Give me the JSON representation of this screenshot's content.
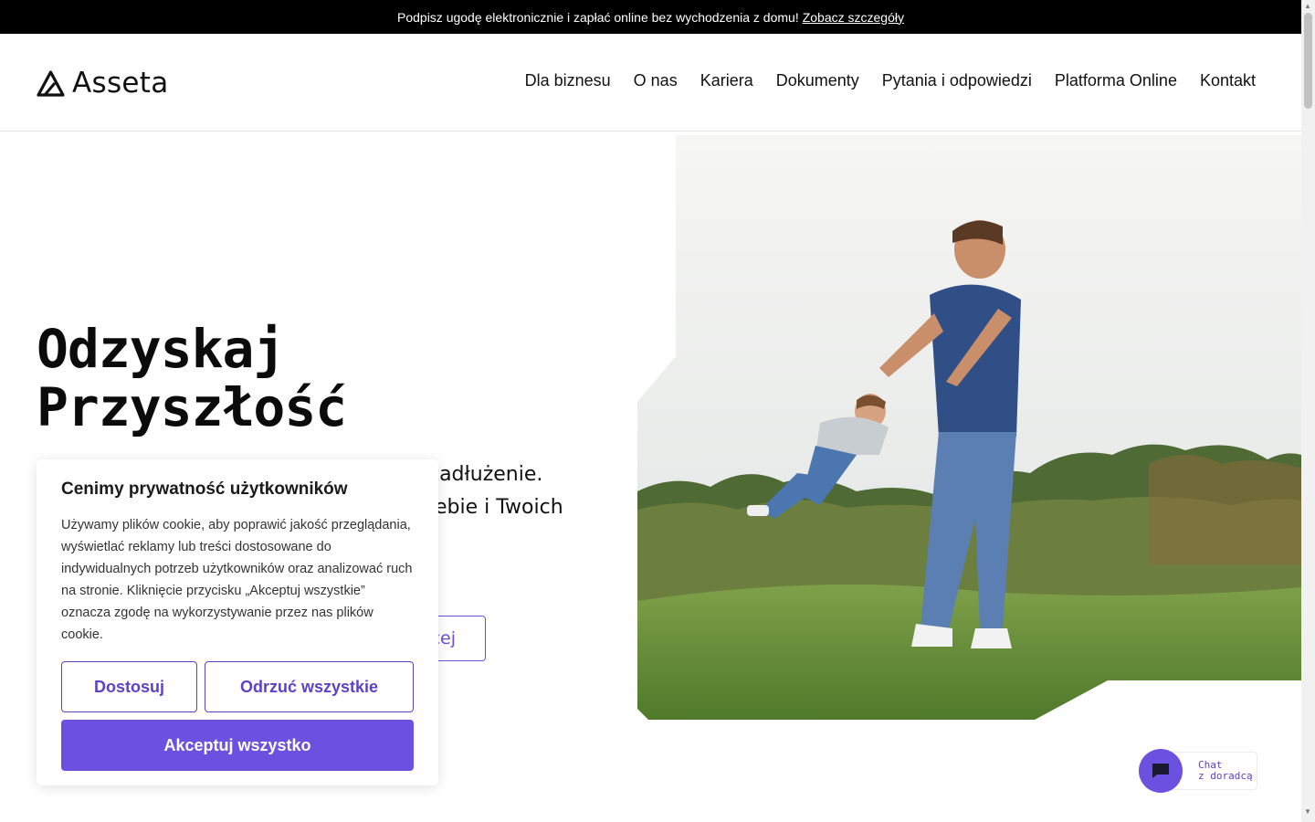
{
  "announcement": {
    "text": "Podpisz ugodę elektronicznie i zapłać online bez wychodzenia z domu!",
    "link": "Zobacz szczegóły"
  },
  "header": {
    "logo_text": "Asseta",
    "nav": [
      "Dla biznesu",
      "O nas",
      "Kariera",
      "Dokumenty",
      "Pytania i odpowiedzi",
      "Platforma Online",
      "Kontakt"
    ]
  },
  "hero": {
    "title_line1": "Odzyskaj",
    "title_line2": "Przyszłość",
    "subtitle_line1": "e zadłużenie.",
    "subtitle_line2": "ebie i Twoich",
    "button_fragment": "cej"
  },
  "cookie": {
    "title": "Cenimy prywatność użytkowników",
    "body": "Używamy plików cookie, aby poprawić jakość przeglądania, wyświetlać reklamy lub treści dostosowane do indywidualnych potrzeb użytkowników oraz analizować ruch na stronie. Kliknięcie przycisku „Akceptuj wszystkie” oznacza zgodę na wykorzystywanie przez nas plików cookie.",
    "customize": "Dostosuj",
    "reject": "Odrzuć wszystkie",
    "accept": "Akceptuj wszystko"
  },
  "chat": {
    "line1": "Chat",
    "line2": "z doradcą"
  },
  "colors": {
    "accent": "#6b51df",
    "topbar": "#000000",
    "text": "#111111"
  }
}
